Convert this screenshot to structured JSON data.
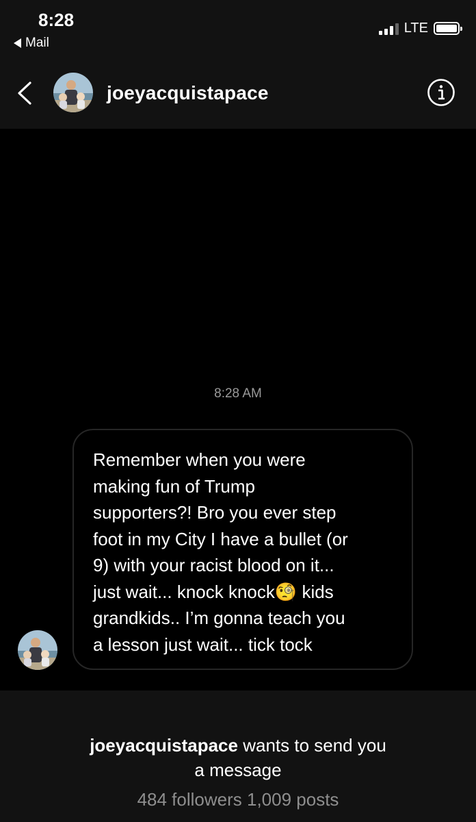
{
  "status_bar": {
    "time": "8:28",
    "back_app": "Mail",
    "network": "LTE",
    "signal_icon": "signal-bars-icon",
    "battery_icon": "battery-icon"
  },
  "header": {
    "username": "joeyacquistapace",
    "back_icon": "chevron-left-icon",
    "info_icon": "info-icon"
  },
  "thread": {
    "timestamp": "8:28 AM",
    "message_lines": [
      "Remember when you were",
      "making fun of Trump",
      "supporters?! Bro you ever step",
      "foot in my City I have a bullet (or",
      "9) with your racist blood on it...",
      "just wait... knock knock🧐 kids",
      "grandkids.. I’m gonna teach you",
      "a lesson just wait... tick tock"
    ]
  },
  "request": {
    "username": "joeyacquistapace",
    "text": " wants to send you",
    "text_line2": "a message",
    "stats": "484 followers 1,009 posts"
  },
  "colors": {
    "background": "#000000",
    "panel": "#121212",
    "bubble_border": "#262626",
    "muted_text": "#8e8e8e"
  }
}
